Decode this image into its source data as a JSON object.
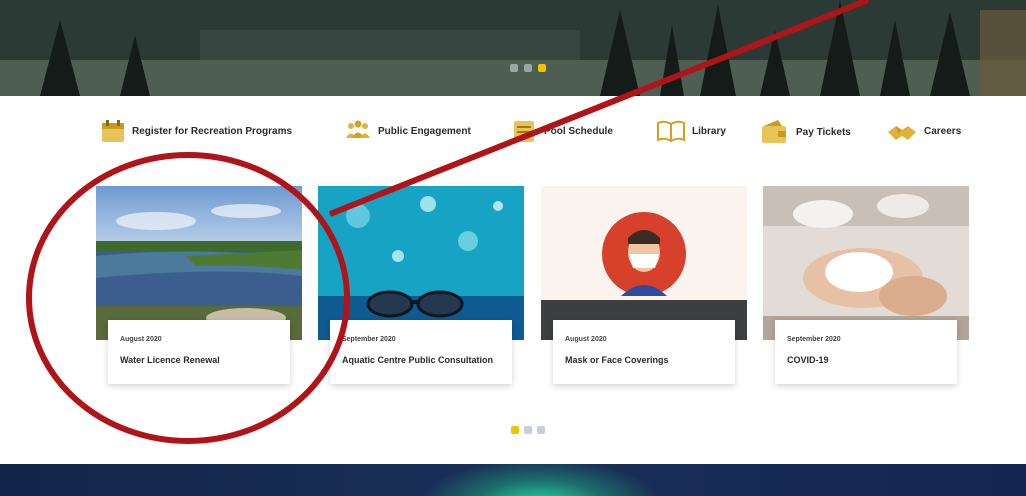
{
  "hero": {
    "dots": [
      false,
      false,
      true
    ],
    "dot_active_color": "#f2c200"
  },
  "quick_links": [
    {
      "label": "Register for Recreation Programs",
      "icon": "calendar-icon"
    },
    {
      "label": "Public Engagement",
      "icon": "people-icon"
    },
    {
      "label": "Pool Schedule",
      "icon": "pool-schedule-icon"
    },
    {
      "label": "Library",
      "icon": "book-icon"
    },
    {
      "label": "Pay Tickets",
      "icon": "wallet-icon"
    },
    {
      "label": "Careers",
      "icon": "handshake-icon"
    }
  ],
  "cards": [
    {
      "date": "August 2020",
      "title": "Water Licence Renewal",
      "image": "river-landscape"
    },
    {
      "date": "September 2020",
      "title": "Aquatic Centre Public Consultation",
      "image": "pool-goggles"
    },
    {
      "date": "August 2020",
      "title": "Mask or Face Coverings",
      "image": "face-mask-illustration"
    },
    {
      "date": "September 2020",
      "title": "COVID-19",
      "image": "hand-washing"
    }
  ],
  "card_pager": {
    "dots": [
      true,
      false,
      false
    ]
  },
  "colors": {
    "accent": "#f2c200",
    "annotation": "#b01318"
  }
}
